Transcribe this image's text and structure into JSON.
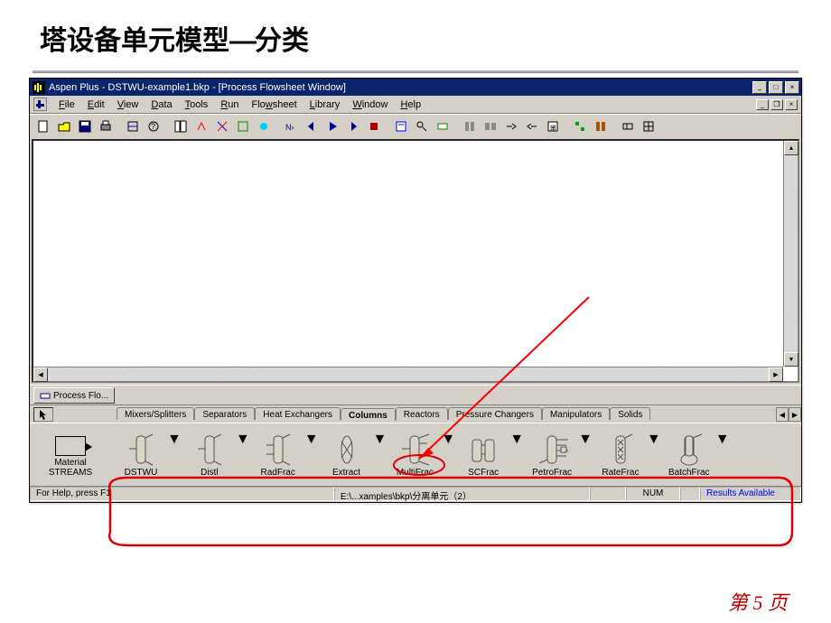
{
  "slide": {
    "title_left": "塔设备单元模型",
    "title_dash": "—",
    "title_right": "分类"
  },
  "window": {
    "title": "Aspen Plus - DSTWU-example1.bkp - [Process Flowsheet Window]",
    "menus": [
      {
        "label": "File",
        "u": "F"
      },
      {
        "label": "Edit",
        "u": "E"
      },
      {
        "label": "View",
        "u": "V"
      },
      {
        "label": "Data",
        "u": "D"
      },
      {
        "label": "Tools",
        "u": "T"
      },
      {
        "label": "Run",
        "u": "R"
      },
      {
        "label": "Flowsheet",
        "u": "w"
      },
      {
        "label": "Library",
        "u": "L"
      },
      {
        "label": "Window",
        "u": "W"
      },
      {
        "label": "Help",
        "u": "H"
      }
    ],
    "taskbar_tab": "Process Flo...",
    "palette_tabs": [
      "Mixers/Splitters",
      "Separators",
      "Heat Exchangers",
      "Columns",
      "Reactors",
      "Pressure Changers",
      "Manipulators",
      "Solids"
    ],
    "active_palette_tab": "Columns",
    "stream_label_top": "Material",
    "stream_label_bottom": "STREAMS",
    "models": [
      "DSTWU",
      "Distl",
      "RadFrac",
      "Extract",
      "MultiFrac",
      "SCFrac",
      "PetroFrac",
      "RateFrac",
      "BatchFrac"
    ],
    "status": {
      "help": "For Help, press F1",
      "path": "E:\\...xamples\\bkp\\分离单元（2）",
      "num": "NUM",
      "results": "Results Available"
    }
  },
  "footer": {
    "text": "第 5 页"
  }
}
